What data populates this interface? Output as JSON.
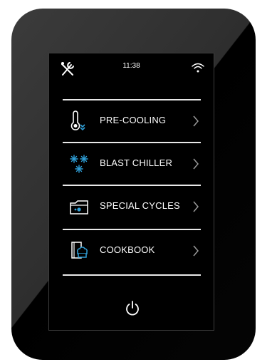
{
  "status_bar": {
    "time": "11:38",
    "left_icon": "tools-icon",
    "right_icon": "wifi-icon"
  },
  "menu": {
    "items": [
      {
        "label": "PRE-COOLING",
        "icon": "thermometer-icon"
      },
      {
        "label": "BLAST CHILLER",
        "icon": "snowflakes-icon"
      },
      {
        "label": "SPECIAL CYCLES",
        "icon": "folder-icon"
      },
      {
        "label": "COOKBOOK",
        "icon": "cookbook-icon"
      }
    ],
    "chevron_icon": "chevron-right-icon"
  },
  "power": {
    "icon": "power-icon"
  },
  "colors": {
    "accent": "#2f9fd8",
    "text": "#ffffff",
    "divider": "#e8e8e8",
    "screen_bg": "#000000",
    "bezel": "#333333"
  }
}
